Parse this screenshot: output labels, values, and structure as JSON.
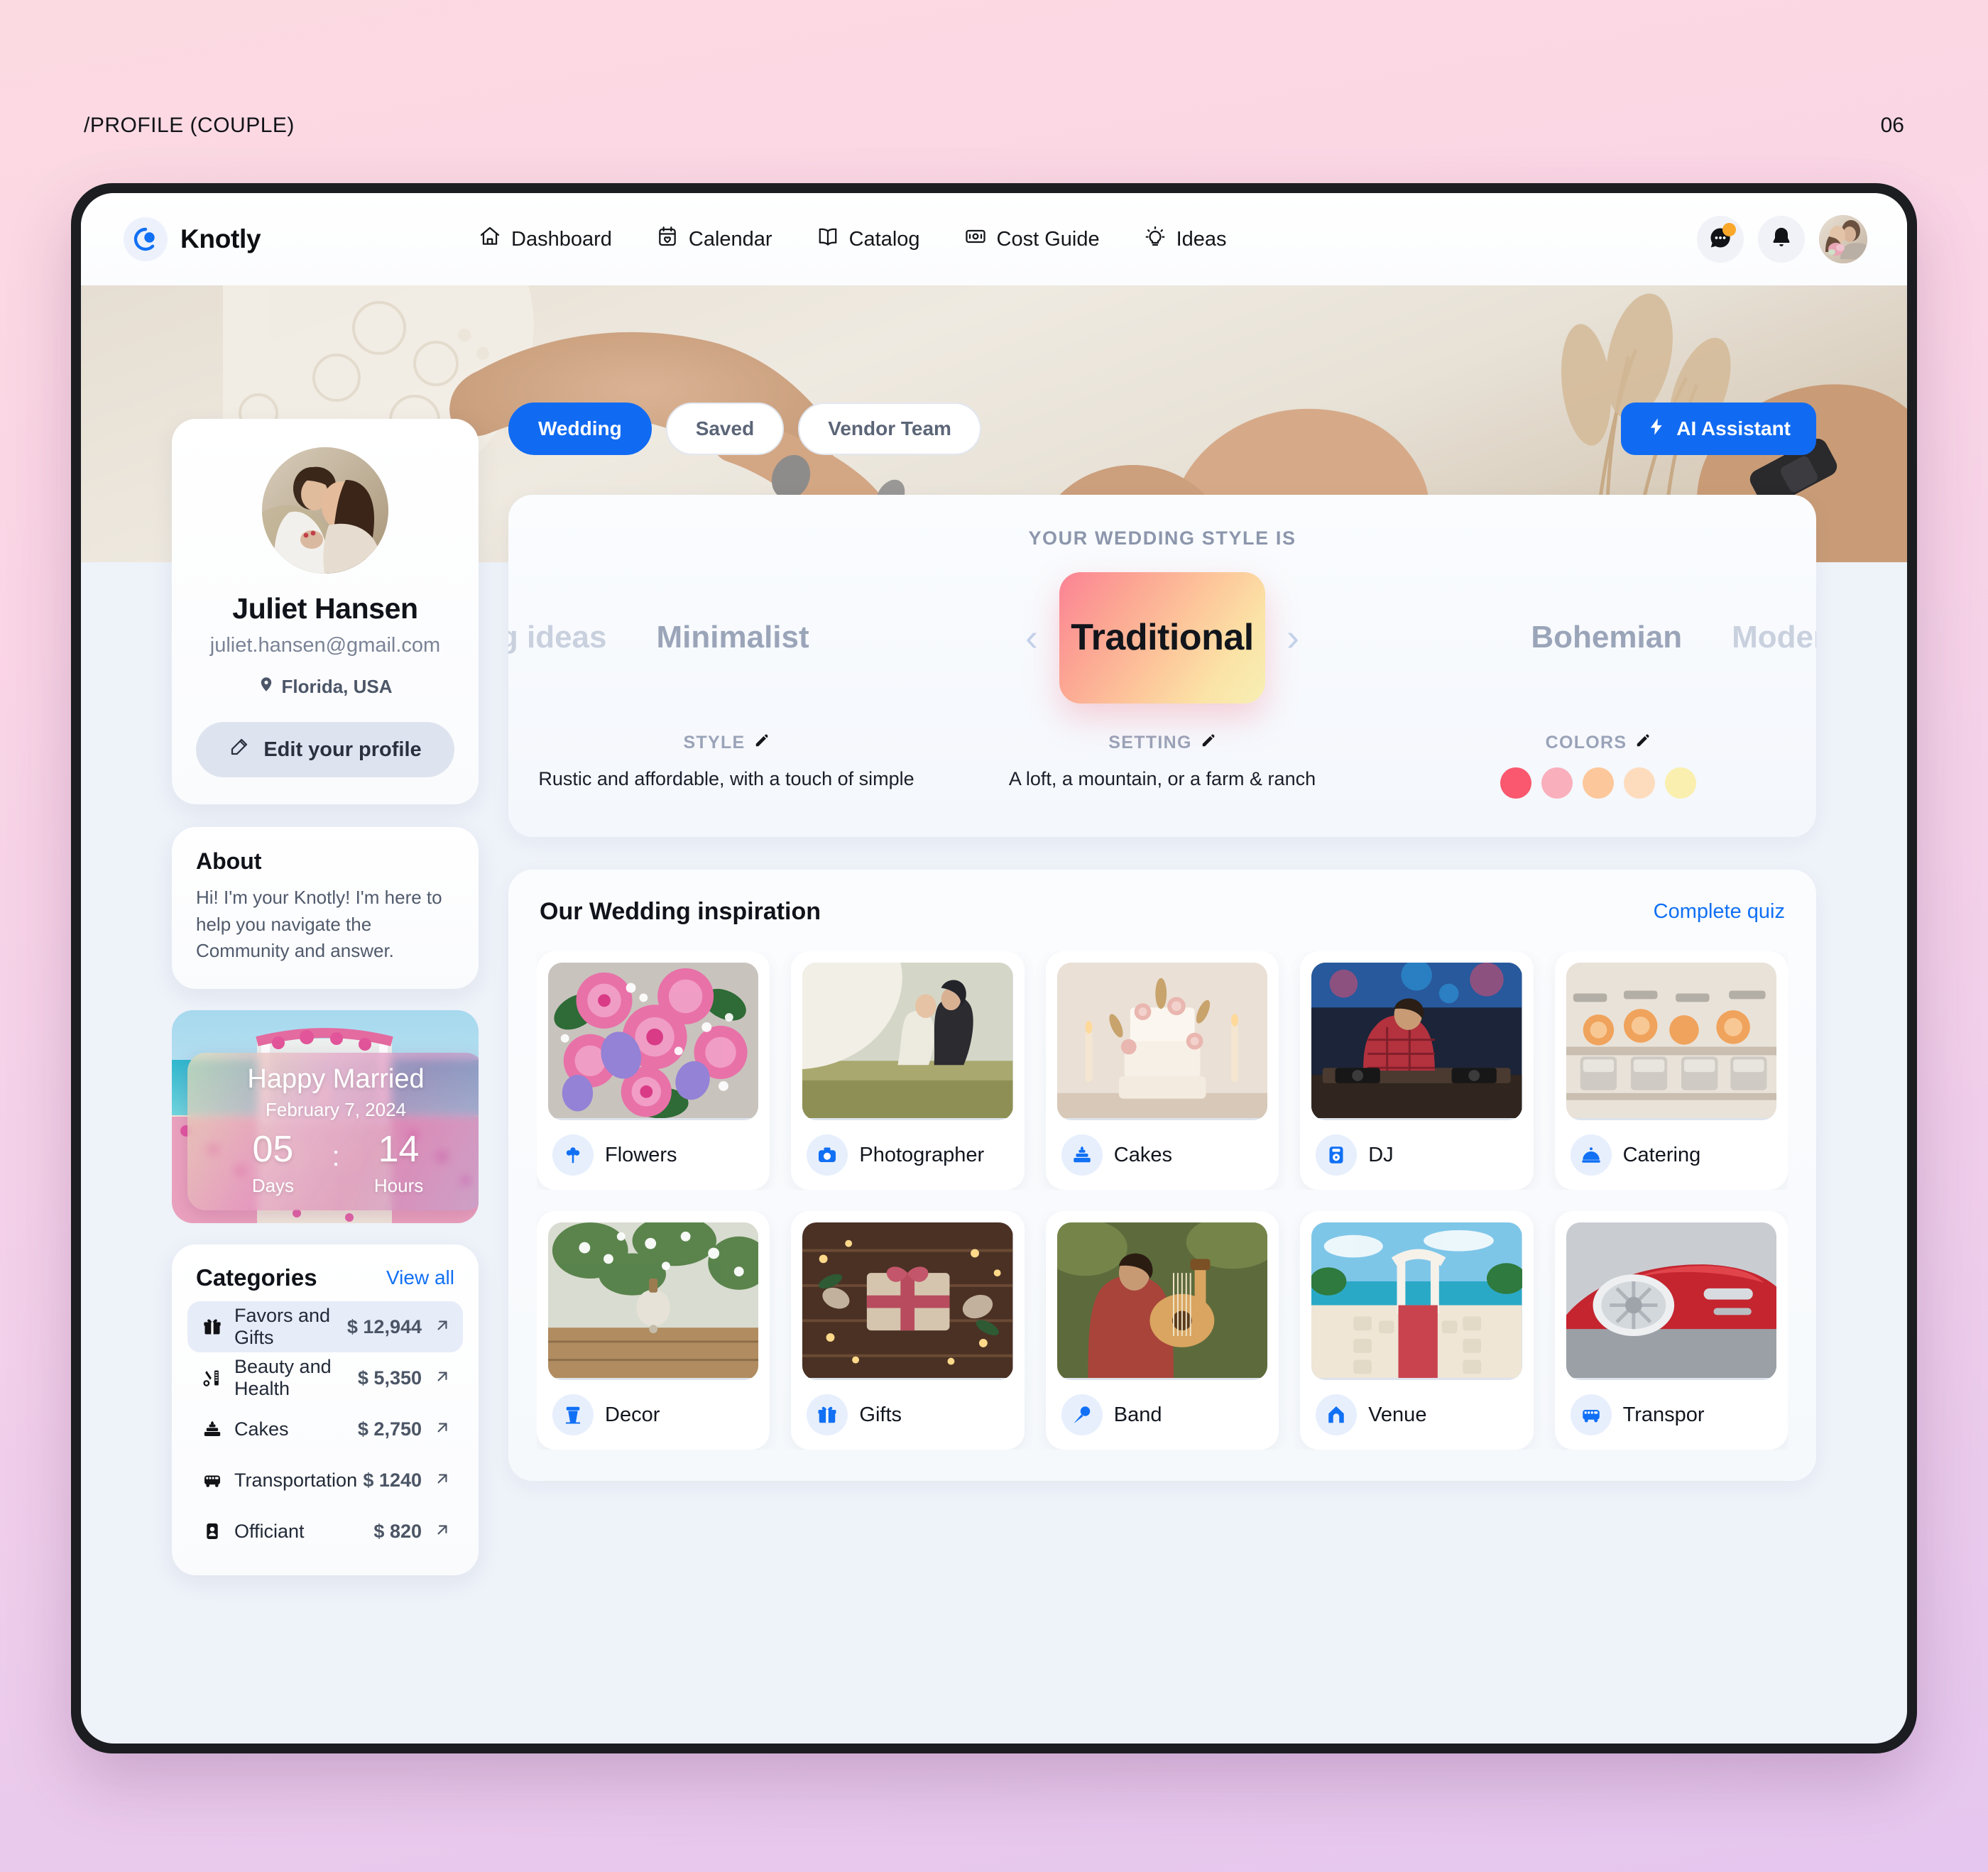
{
  "page": {
    "breadcrumb": "/PROFILE (COUPLE)",
    "number": "06"
  },
  "brand": {
    "name": "Knotly",
    "logo_icon": "knotly-logo-icon"
  },
  "nav": {
    "items": [
      {
        "label": "Dashboard",
        "icon": "home-icon"
      },
      {
        "label": "Calendar",
        "icon": "calendar-heart-icon"
      },
      {
        "label": "Catalog",
        "icon": "book-open-icon"
      },
      {
        "label": "Cost Guide",
        "icon": "money-bill-icon"
      },
      {
        "label": "Ideas",
        "icon": "lightbulb-icon"
      }
    ],
    "actions": [
      {
        "name": "messages",
        "icon": "chat-bubble-icon",
        "has_badge": true
      },
      {
        "name": "notifications",
        "icon": "bell-icon",
        "has_badge": false
      }
    ],
    "avatar_icon": "user-avatar"
  },
  "profile": {
    "name": "Juliet Hansen",
    "email": "juliet.hansen@gmail.com",
    "location": "Florida, USA",
    "location_icon": "map-pin-icon",
    "edit_label": "Edit your profile",
    "edit_icon": "edit-pencil-icon"
  },
  "about": {
    "title": "About",
    "text": "Hi! I'm your Knotly! I'm here to help you navigate the Community and answer."
  },
  "countdown": {
    "title": "Happy Married",
    "date": "February 7, 2024",
    "separator": ":",
    "units": [
      {
        "value": "05",
        "label": "Days"
      },
      {
        "value": "14",
        "label": "Hours"
      }
    ]
  },
  "categories": {
    "title": "Categories",
    "view_all": "View all",
    "items": [
      {
        "label": "Favors and Gifts",
        "amount": "$ 12,944",
        "icon": "gift-icon",
        "active": true
      },
      {
        "label": "Beauty and Health",
        "amount": "$ 5,350",
        "icon": "scissors-comb-icon",
        "active": false
      },
      {
        "label": "Cakes",
        "amount": "$ 2,750",
        "icon": "cake-icon",
        "active": false
      },
      {
        "label": "Transportation",
        "amount": "$ 1240",
        "icon": "bus-icon",
        "active": false
      },
      {
        "label": "Officiant",
        "amount": "$ 820",
        "icon": "person-card-icon",
        "active": false
      }
    ]
  },
  "tabs": [
    {
      "label": "Wedding",
      "active": true
    },
    {
      "label": "Saved",
      "active": false
    },
    {
      "label": "Vendor Team",
      "active": false
    }
  ],
  "ai_button": {
    "label": "AI Assistant",
    "icon": "lightning-bolt-icon"
  },
  "style_section": {
    "heading": "YOUR WEDDING STYLE IS",
    "selected": "Traditional",
    "left_far": "ng ideas",
    "left_near": "Minimalist",
    "right_near": "Bohemian",
    "right_far": "Modern",
    "prev_icon": "chevron-left-icon",
    "next_icon": "chevron-right-icon",
    "facts": [
      {
        "heading": "STYLE",
        "body": "Rustic and affordable, with a touch of simple",
        "edit_icon": "edit-pencil-icon"
      },
      {
        "heading": "SETTING",
        "body": "A loft, a mountain, or a farm & ranch",
        "edit_icon": "edit-pencil-icon"
      }
    ],
    "colors": {
      "heading": "COLORS",
      "edit_icon": "edit-pencil-icon",
      "swatches": [
        "#F9586E",
        "#F9AFBC",
        "#FCC79A",
        "#FDDCBE",
        "#FAEFAE"
      ]
    }
  },
  "inspiration": {
    "title": "Our Wedding inspiration",
    "link": "Complete quiz",
    "row1": [
      {
        "label": "Flowers",
        "icon": "flower-icon"
      },
      {
        "label": "Photographer",
        "icon": "camera-icon"
      },
      {
        "label": "Cakes",
        "icon": "cake-icon"
      },
      {
        "label": "DJ",
        "icon": "dj-deck-icon"
      },
      {
        "label": "Catering",
        "icon": "cloche-icon"
      }
    ],
    "row2": [
      {
        "label": "Decor",
        "icon": "decor-icon"
      },
      {
        "label": "Gifts",
        "icon": "gift-icon"
      },
      {
        "label": "Band",
        "icon": "microphone-icon"
      },
      {
        "label": "Venue",
        "icon": "arch-venue-icon"
      },
      {
        "label": "Transpor",
        "icon": "bus-icon"
      }
    ]
  }
}
